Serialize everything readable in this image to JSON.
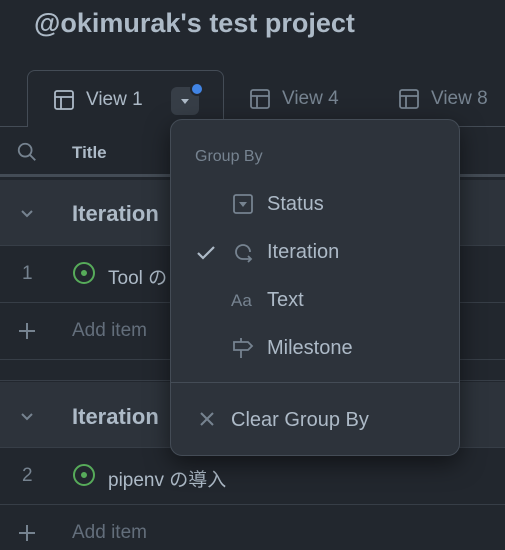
{
  "project": {
    "title": "@okimurak's test project"
  },
  "tabs": [
    {
      "label": "View 1",
      "active": true
    },
    {
      "label": "View 4",
      "active": false
    },
    {
      "label": "View 8",
      "active": false
    }
  ],
  "table": {
    "title_column": "Title",
    "groups": [
      {
        "label": "Iteration",
        "items": [
          {
            "number": "1",
            "title": "Tool の"
          }
        ],
        "add_label": "Add item"
      },
      {
        "label": "Iteration",
        "items": [
          {
            "number": "2",
            "title": "pipenv の導入"
          }
        ],
        "add_label": "Add item"
      }
    ]
  },
  "group_by_menu": {
    "heading": "Group By",
    "options": [
      {
        "label": "Status",
        "icon": "single-select-icon",
        "checked": false
      },
      {
        "label": "Iteration",
        "icon": "iterations-icon",
        "checked": true
      },
      {
        "label": "Text",
        "icon": "typography-icon",
        "checked": false
      },
      {
        "label": "Milestone",
        "icon": "milestone-icon",
        "checked": false
      }
    ],
    "clear_label": "Clear Group By"
  },
  "colors": {
    "background": "#22272e",
    "status_open": "#57ab5a",
    "notification_dot": "#4184e4"
  }
}
